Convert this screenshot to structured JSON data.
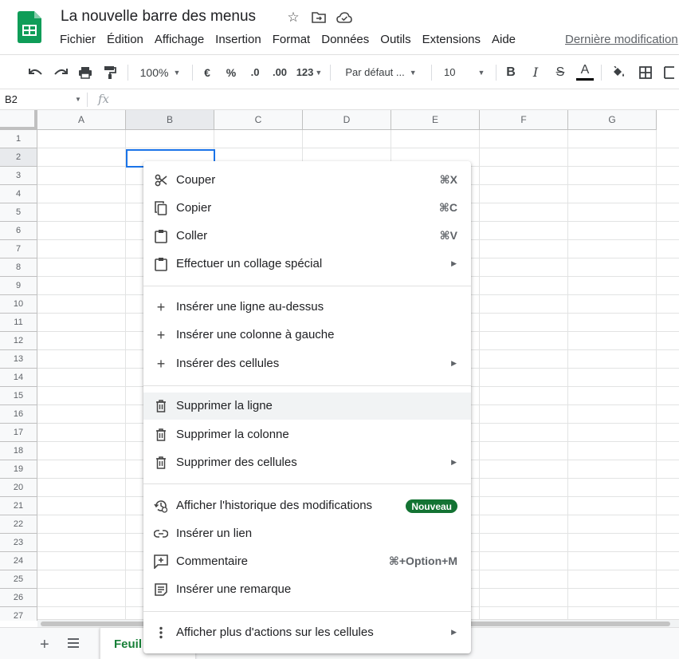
{
  "header": {
    "title": "La nouvelle barre des menus",
    "last_edit": "Dernière modification",
    "menus": [
      "Fichier",
      "Édition",
      "Affichage",
      "Insertion",
      "Format",
      "Données",
      "Outils",
      "Extensions",
      "Aide"
    ]
  },
  "toolbar": {
    "zoom": "100%",
    "currency": "€",
    "percent": "%",
    "decrease_decimal": ".0",
    "increase_decimal": ".00",
    "more_formats": "123",
    "font": "Par défaut ...",
    "font_size": "10",
    "bold": "B",
    "italic": "I",
    "strike": "S",
    "text_color": "A"
  },
  "formula_bar": {
    "cell_ref": "B2",
    "fx": "fx"
  },
  "grid": {
    "columns": [
      "A",
      "B",
      "C",
      "D",
      "E",
      "F",
      "G"
    ],
    "rows": [
      "1",
      "2",
      "3",
      "4",
      "5",
      "6",
      "7",
      "8",
      "9",
      "10",
      "11",
      "12",
      "13",
      "14",
      "15",
      "16",
      "17",
      "18",
      "19",
      "20",
      "21",
      "22",
      "23",
      "24",
      "25",
      "26",
      "27"
    ],
    "selected_column": "B",
    "selected_row": "2"
  },
  "context_menu": {
    "cut": {
      "label": "Couper",
      "shortcut": "⌘X"
    },
    "copy": {
      "label": "Copier",
      "shortcut": "⌘C"
    },
    "paste": {
      "label": "Coller",
      "shortcut": "⌘V"
    },
    "paste_special": {
      "label": "Effectuer un collage spécial"
    },
    "insert_row_above": {
      "label": "Insérer une ligne au-dessus"
    },
    "insert_col_left": {
      "label": "Insérer une colonne à gauche"
    },
    "insert_cells": {
      "label": "Insérer des cellules"
    },
    "delete_row": {
      "label": "Supprimer la ligne"
    },
    "delete_column": {
      "label": "Supprimer la colonne"
    },
    "delete_cells": {
      "label": "Supprimer des cellules"
    },
    "edit_history": {
      "label": "Afficher l'historique des modifications",
      "badge": "Nouveau"
    },
    "insert_link": {
      "label": "Insérer un lien"
    },
    "comment": {
      "label": "Commentaire",
      "shortcut": "⌘+Option+M"
    },
    "insert_note": {
      "label": "Insérer une remarque"
    },
    "more_actions": {
      "label": "Afficher plus d'actions sur les cellules"
    }
  },
  "sheets": {
    "active_tab": "Feuil"
  },
  "colors": {
    "accent": "#1a73e8",
    "sheets_green": "#0f9d58",
    "badge_green": "#137333"
  }
}
